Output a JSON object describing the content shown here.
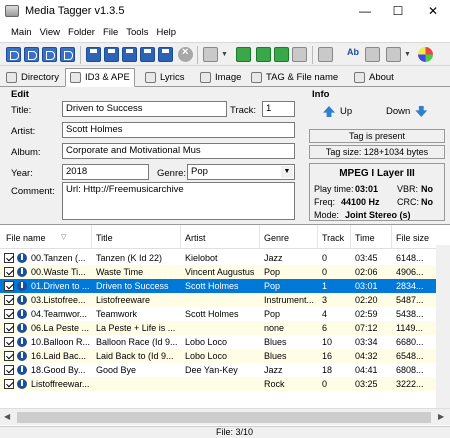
{
  "window": {
    "title": "Media Tagger v1.3.5"
  },
  "menu": [
    "Main",
    "View",
    "Folder",
    "File",
    "Tools",
    "Help"
  ],
  "tabs": [
    "Directory",
    "ID3 & APE",
    "Lyrics",
    "Image",
    "TAG & File name",
    "About"
  ],
  "edit": {
    "heading": "Edit",
    "labels": {
      "title": "Title:",
      "track": "Track:",
      "artist": "Artist:",
      "album": "Album:",
      "year": "Year:",
      "genre": "Genre:",
      "comment": "Comment:"
    },
    "values": {
      "title": "Driven to Success",
      "track": "1",
      "artist": "Scott Holmes",
      "album": "Corporate and Motivational Mus",
      "year": "2018",
      "genre": "Pop",
      "comment": "Url: Http://Freemusicarchive"
    }
  },
  "info": {
    "heading": "Info",
    "up_label": "Up",
    "down_label": "Down",
    "tag_present": "Tag is present",
    "tag_size": "Tag size: 128+1034 bytes",
    "mpeg_title": "MPEG I Layer III",
    "play_time_label": "Play time:",
    "play_time": "03:01",
    "vbr_label": "VBR:",
    "vbr": "No",
    "freq_label": "Freq:",
    "freq": "44100 Hz",
    "crc_label": "CRC:",
    "crc": "No",
    "mode_label": "Mode:",
    "mode": "Joint Stereo (s)"
  },
  "filelist": {
    "columns": [
      "File name",
      "Title",
      "Artist",
      "Genre",
      "Track",
      "Time",
      "File size"
    ],
    "rows": [
      {
        "file": "00.Tanzen (...",
        "title": "Tanzen (K Id 22)",
        "artist": "Kielobot",
        "genre": "Jazz",
        "track": "0",
        "time": "03:45",
        "size": "6148..."
      },
      {
        "file": "00.Waste Ti...",
        "title": "Waste Time",
        "artist": "Vincent Augustus",
        "genre": "Pop",
        "track": "0",
        "time": "02:06",
        "size": "4906..."
      },
      {
        "file": "01.Driven to ...",
        "title": "Driven to Success",
        "artist": "Scott Holmes",
        "genre": "Pop",
        "track": "1",
        "time": "03:01",
        "size": "2834..."
      },
      {
        "file": "03.Listofree...",
        "title": "Listofreeware",
        "artist": "",
        "genre": "Instrument...",
        "track": "3",
        "time": "02:20",
        "size": "5487..."
      },
      {
        "file": "04.Teamwor...",
        "title": "Teamwork",
        "artist": "Scott Holmes",
        "genre": "Pop",
        "track": "4",
        "time": "02:59",
        "size": "5438..."
      },
      {
        "file": "06.La Peste ...",
        "title": "La Peste + Life is ...",
        "artist": "",
        "genre": "none",
        "track": "6",
        "time": "07:12",
        "size": "1149..."
      },
      {
        "file": "10.Balloon R...",
        "title": "Balloon Race (Id 9...",
        "artist": "Lobo Loco",
        "genre": "Blues",
        "track": "10",
        "time": "03:34",
        "size": "6680..."
      },
      {
        "file": "16.Laid Bac...",
        "title": "Laid Back to (Id 9...",
        "artist": "Lobo Loco",
        "genre": "Blues",
        "track": "16",
        "time": "04:32",
        "size": "6548..."
      },
      {
        "file": "18.Good By...",
        "title": "Good Bye",
        "artist": "Dee Yan-Key",
        "genre": "Jazz",
        "track": "18",
        "time": "04:41",
        "size": "6808..."
      },
      {
        "file": "Listoffreewar...",
        "title": "",
        "artist": "",
        "genre": "Rock",
        "track": "0",
        "time": "03:25",
        "size": "3222..."
      }
    ]
  },
  "status": {
    "text": "File: 3/10"
  },
  "colors": {
    "selection": "#0078d7",
    "alt_row": "#fffde6",
    "nav_arrow": "#2f7fd0"
  }
}
